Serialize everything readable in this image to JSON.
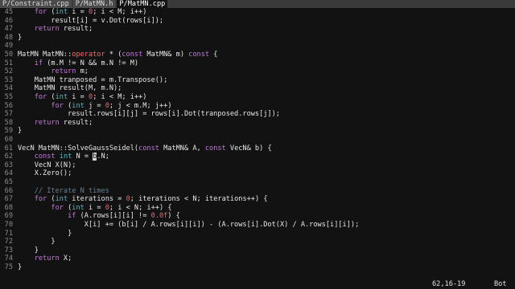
{
  "tabs": [
    {
      "label": "P/Constraint.cpp",
      "active": false
    },
    {
      "label": "P/MatMN.h",
      "active": false
    },
    {
      "label": "P/MatMN.cpp",
      "active": true
    }
  ],
  "lines": [
    {
      "n": "45",
      "segs": [
        [
          "    ",
          ""
        ],
        [
          "for",
          "kw"
        ],
        [
          " (",
          ""
        ],
        [
          "int",
          "ty"
        ],
        [
          " i = ",
          ""
        ],
        [
          "0",
          "num"
        ],
        [
          "; i < M; i++)",
          ""
        ]
      ]
    },
    {
      "n": "46",
      "segs": [
        [
          "        result[i] = v.Dot(rows[i]);",
          ""
        ]
      ]
    },
    {
      "n": "47",
      "segs": [
        [
          "    ",
          ""
        ],
        [
          "return",
          "kw"
        ],
        [
          " result;",
          ""
        ]
      ]
    },
    {
      "n": "48",
      "segs": [
        [
          "}",
          ""
        ]
      ]
    },
    {
      "n": "49",
      "segs": [
        [
          "",
          ""
        ]
      ]
    },
    {
      "n": "50",
      "segs": [
        [
          "MatMN MatMN::",
          ""
        ],
        [
          "operator",
          "op"
        ],
        [
          " * (",
          ""
        ],
        [
          "const",
          "kw"
        ],
        [
          " MatMN& m) ",
          ""
        ],
        [
          "const",
          "kw"
        ],
        [
          " {",
          ""
        ]
      ]
    },
    {
      "n": "51",
      "segs": [
        [
          "    ",
          ""
        ],
        [
          "if",
          "kw"
        ],
        [
          " (m.M != N && m.N != M)",
          ""
        ]
      ]
    },
    {
      "n": "52",
      "segs": [
        [
          "        ",
          ""
        ],
        [
          "return",
          "kw"
        ],
        [
          " m;",
          ""
        ]
      ]
    },
    {
      "n": "53",
      "segs": [
        [
          "    MatMN tranposed = m.Transpose();",
          ""
        ]
      ]
    },
    {
      "n": "54",
      "segs": [
        [
          "    MatMN result(M, m.N);",
          ""
        ]
      ]
    },
    {
      "n": "55",
      "segs": [
        [
          "    ",
          ""
        ],
        [
          "for",
          "kw"
        ],
        [
          " (",
          ""
        ],
        [
          "int",
          "ty"
        ],
        [
          " i = ",
          ""
        ],
        [
          "0",
          "num"
        ],
        [
          "; i < M; i++)",
          ""
        ]
      ]
    },
    {
      "n": "56",
      "segs": [
        [
          "        ",
          ""
        ],
        [
          "for",
          "kw"
        ],
        [
          " (",
          ""
        ],
        [
          "int",
          "ty"
        ],
        [
          " j = ",
          ""
        ],
        [
          "0",
          "num"
        ],
        [
          "; j < m.M; j++)",
          ""
        ]
      ]
    },
    {
      "n": "57",
      "segs": [
        [
          "            result.rows[i][j] = rows[i].Dot(tranposed.rows[j]);",
          ""
        ]
      ]
    },
    {
      "n": "58",
      "segs": [
        [
          "    ",
          ""
        ],
        [
          "return",
          "kw"
        ],
        [
          " result;",
          ""
        ]
      ]
    },
    {
      "n": "59",
      "segs": [
        [
          "}",
          ""
        ]
      ]
    },
    {
      "n": "60",
      "segs": [
        [
          "",
          ""
        ]
      ]
    },
    {
      "n": "61",
      "segs": [
        [
          "VecN MatMN::SolveGaussSeidel(",
          ""
        ],
        [
          "const",
          "kw"
        ],
        [
          " MatMN& A, ",
          ""
        ],
        [
          "const",
          "kw"
        ],
        [
          " VecN& b) {",
          ""
        ]
      ]
    },
    {
      "n": "62",
      "segs": [
        [
          "    ",
          ""
        ],
        [
          "const",
          "kw"
        ],
        [
          " ",
          ""
        ],
        [
          "int",
          "ty"
        ],
        [
          " N = ",
          ""
        ],
        [
          "b",
          "cursor"
        ],
        [
          ".N;",
          ""
        ]
      ]
    },
    {
      "n": "63",
      "segs": [
        [
          "    VecN X(N);",
          ""
        ]
      ]
    },
    {
      "n": "64",
      "segs": [
        [
          "    X.Zero();",
          ""
        ]
      ]
    },
    {
      "n": "65",
      "segs": [
        [
          "",
          ""
        ]
      ]
    },
    {
      "n": "66",
      "segs": [
        [
          "    ",
          ""
        ],
        [
          "// Iterate N times",
          "cm"
        ]
      ]
    },
    {
      "n": "67",
      "segs": [
        [
          "    ",
          ""
        ],
        [
          "for",
          "kw"
        ],
        [
          " (",
          ""
        ],
        [
          "int",
          "ty"
        ],
        [
          " iterations = ",
          ""
        ],
        [
          "0",
          "num"
        ],
        [
          "; iterations < N; iterations++) {",
          ""
        ]
      ]
    },
    {
      "n": "68",
      "segs": [
        [
          "        ",
          ""
        ],
        [
          "for",
          "kw"
        ],
        [
          " (",
          ""
        ],
        [
          "int",
          "ty"
        ],
        [
          " i = ",
          ""
        ],
        [
          "0",
          "num"
        ],
        [
          "; i < N; i++) {",
          ""
        ]
      ]
    },
    {
      "n": "69",
      "segs": [
        [
          "            ",
          ""
        ],
        [
          "if",
          "kw"
        ],
        [
          " (A.rows[i][i] != ",
          ""
        ],
        [
          "0.0f",
          "num"
        ],
        [
          ") {",
          ""
        ]
      ]
    },
    {
      "n": "70",
      "segs": [
        [
          "                X[i] += (b[i] / A.rows[i][i]) - (A.rows[i].Dot(X) / A.rows[i][i]);",
          ""
        ]
      ]
    },
    {
      "n": "71",
      "segs": [
        [
          "            }",
          ""
        ]
      ]
    },
    {
      "n": "72",
      "segs": [
        [
          "        }",
          ""
        ]
      ]
    },
    {
      "n": "73",
      "segs": [
        [
          "    }",
          ""
        ]
      ]
    },
    {
      "n": "74",
      "segs": [
        [
          "    ",
          ""
        ],
        [
          "return",
          "kw"
        ],
        [
          " X;",
          ""
        ]
      ]
    },
    {
      "n": "75",
      "segs": [
        [
          "}",
          ""
        ]
      ]
    }
  ],
  "status": {
    "position": "62,16-19",
    "scroll": "Bot"
  }
}
